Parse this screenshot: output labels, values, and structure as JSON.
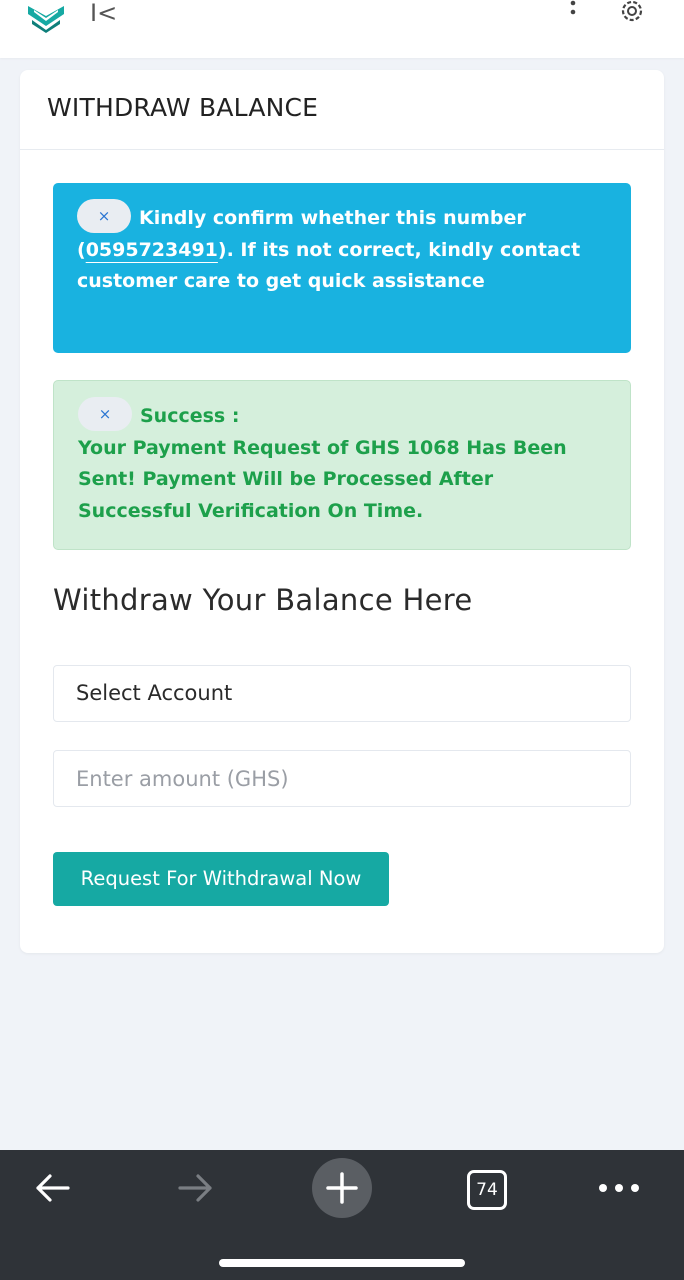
{
  "colors": {
    "brand_teal": "#16a9a3",
    "info_blue": "#19b2e0",
    "success_green": "#1da04b",
    "success_bg": "#d5efdc",
    "browser_bar": "#2f3338"
  },
  "topbar": {
    "logo_icon": "brand-logo-icon",
    "collapse_label": "I<",
    "menu_icon": "kebab-menu-icon",
    "settings_icon": "gear-icon"
  },
  "card": {
    "title": "WITHDRAW BALANCE"
  },
  "info_alert": {
    "close_label": "×",
    "text_before": "Kindly confirm whether this number (",
    "phone_number": "0595723491",
    "text_after": "). If its not correct, kindly contact customer care to get quick assistance"
  },
  "success_alert": {
    "close_label": "×",
    "heading": "Success :",
    "message": "Your Payment Request of GHS 1068 Has Been Sent! Payment Will be Processed After Successful Verification On Time."
  },
  "form": {
    "section_title": "Withdraw Your Balance Here",
    "select_account_value": "Select Account",
    "amount_value": "",
    "amount_placeholder": "Enter amount (GHS)",
    "submit_label": "Request For Withdrawal Now"
  },
  "browser": {
    "back_icon": "back-arrow-icon",
    "forward_icon": "forward-arrow-icon",
    "new_tab_icon": "plus-icon",
    "tabs_count": "74",
    "more_icon": "more-dots-icon"
  }
}
